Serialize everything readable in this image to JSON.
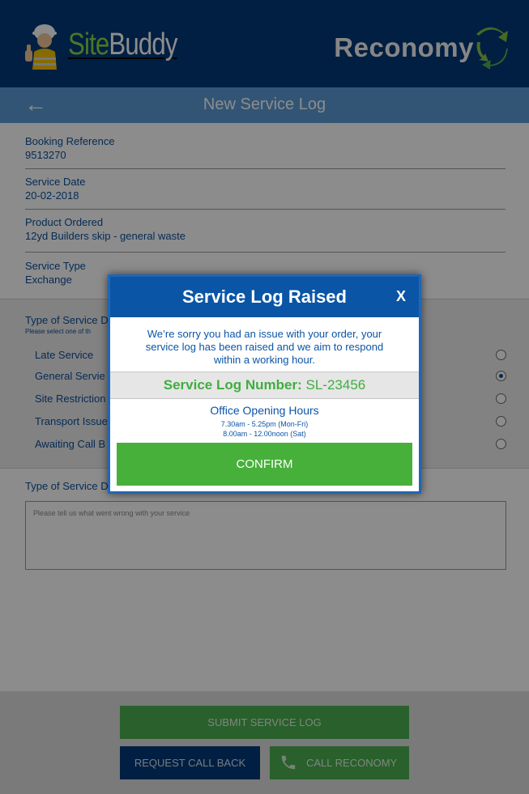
{
  "header": {
    "brand_site": "Site",
    "brand_buddy": "Buddy",
    "partner_logo": "Reconomy"
  },
  "titlebar": {
    "back_icon": "back-arrow-icon",
    "title": "New Service Log"
  },
  "booking": {
    "reference_label": "Booking Reference",
    "reference_value": "9513270",
    "date_label": "Service Date",
    "date_value": "20-02-2018",
    "product_label": "Product Ordered",
    "product_value": "12yd Builders skip - general waste",
    "type_label": "Service Type",
    "type_value": "Exchange"
  },
  "issue_type": {
    "title": "Type of Service D",
    "hint": "Please select one of th",
    "options": [
      {
        "label": "Late Service",
        "selected": false
      },
      {
        "label": "General Servie",
        "selected": true
      },
      {
        "label": "Site Restriction",
        "selected": false
      },
      {
        "label": "Transport Issue",
        "selected": false
      },
      {
        "label": "Awaiting Call B",
        "selected": false
      }
    ]
  },
  "description": {
    "title": "Type of Service D",
    "placeholder": "Please tell us what went wrong with your service"
  },
  "footer": {
    "submit_label": "SUBMIT SERVICE LOG",
    "callback_label": "REQUEST CALL BACK",
    "call_label": "CALL RECONOMY",
    "call_icon": "phone-icon"
  },
  "modal": {
    "title": "Service Log Raised",
    "close_label": "X",
    "message": "We’re sorry you had an issue with your order, your service log has been raised and we aim to respond within a working hour.",
    "log_label": "Service Log Number:",
    "log_value": "SL-23456",
    "hours_title": "Office Opening Hours",
    "hours_weekday": "7.30am - 5.25pm (Mon-Fri)",
    "hours_saturday": "8.00am - 12.00noon (Sat)",
    "confirm_label": "CONFIRM"
  },
  "colors": {
    "header_blue": "#003a79",
    "titlebar_blue": "#5b9bd5",
    "accent_green": "#4caf50",
    "text_blue": "#0b4f9a"
  }
}
